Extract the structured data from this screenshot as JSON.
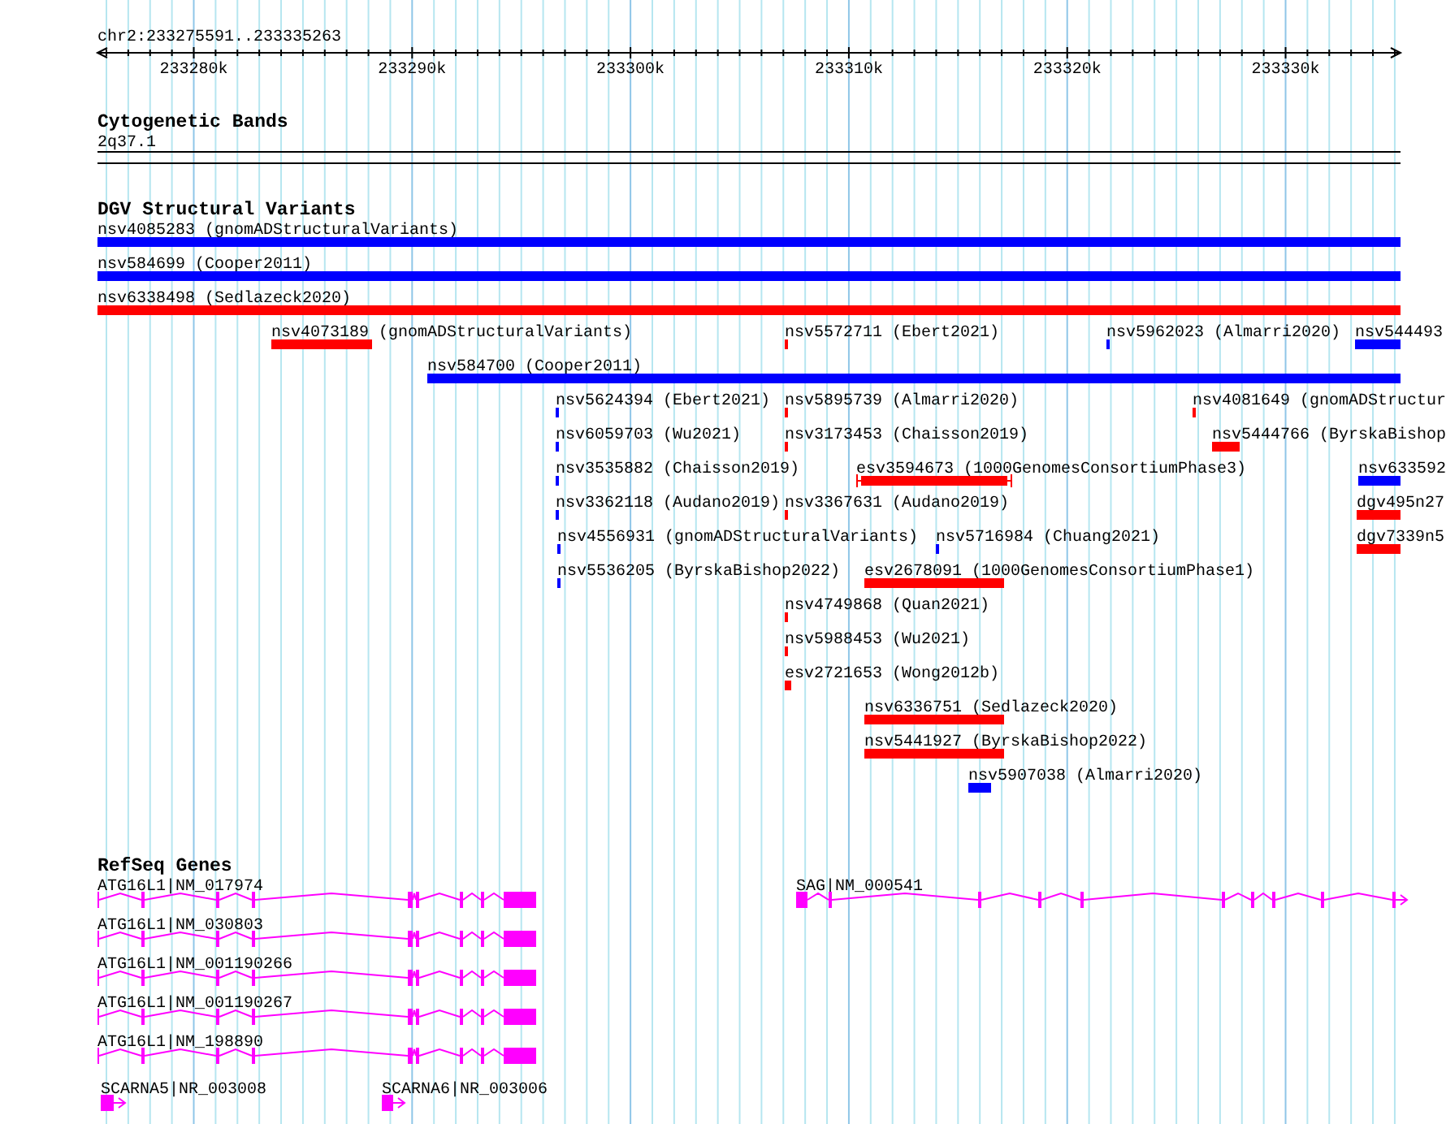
{
  "ruler": {
    "location": "chr2:233275591..233335263",
    "ticks": [
      "233280k",
      "233290k",
      "233300k",
      "233310k",
      "233320k",
      "233330k"
    ]
  },
  "tracks": [
    {
      "kind": "bands",
      "title": "Cytogenetic Bands",
      "bands": [
        {
          "name": "2q37.1"
        }
      ]
    },
    {
      "kind": "variants",
      "title": "DGV Structural Variants",
      "features": [
        {
          "label": "nsv4085283 (gnomADStructuralVariants)",
          "color": "#0000ff",
          "kind": "bar"
        },
        {
          "label": "nsv584699 (Cooper2011)",
          "color": "#0000ff",
          "kind": "bar"
        },
        {
          "label": "nsv6338498 (Sedlazeck2020)",
          "color": "#ff0000",
          "kind": "bar"
        },
        {
          "label": "nsv4073189 (gnomADStructuralVariants)",
          "color": "#ff0000",
          "kind": "bar"
        },
        {
          "label": "nsv5572711 (Ebert2021)",
          "color": "#ff0000",
          "kind": "bar"
        },
        {
          "label": "nsv5962023 (Almarri2020)",
          "color": "#0000ff",
          "kind": "bar"
        },
        {
          "label": "nsv544493",
          "color": "#0000ff",
          "kind": "bar"
        },
        {
          "label": "nsv584700 (Cooper2011)",
          "color": "#0000ff",
          "kind": "bar"
        },
        {
          "label": "nsv5624394 (Ebert2021)",
          "color": "#0000ff",
          "kind": "bar"
        },
        {
          "label": "nsv5895739 (Almarri2020)",
          "color": "#ff0000",
          "kind": "bar"
        },
        {
          "label": "nsv4081649 (gnomADStructur",
          "color": "#ff0000",
          "kind": "bar"
        },
        {
          "label": "nsv6059703 (Wu2021)",
          "color": "#0000ff",
          "kind": "bar"
        },
        {
          "label": "nsv3173453 (Chaisson2019)",
          "color": "#ff0000",
          "kind": "bar"
        },
        {
          "label": "nsv5444766 (ByrskaBishop",
          "color": "#ff0000",
          "kind": "bar"
        },
        {
          "label": "nsv3535882 (Chaisson2019)",
          "color": "#0000ff",
          "kind": "bar"
        },
        {
          "label": "esv3594673 (1000GenomesConsortiumPhase3)",
          "color": "#ff0000",
          "kind": "bounded"
        },
        {
          "label": "nsv633592",
          "color": "#0000ff",
          "kind": "bar"
        },
        {
          "label": "nsv3362118 (Audano2019)",
          "color": "#0000ff",
          "kind": "bar"
        },
        {
          "label": "nsv3367631 (Audano2019)",
          "color": "#ff0000",
          "kind": "bar"
        },
        {
          "label": "dgv495n27",
          "color": "#ff0000",
          "kind": "bar"
        },
        {
          "label": "nsv4556931 (gnomADStructuralVariants)",
          "color": "#0000ff",
          "kind": "bar"
        },
        {
          "label": "nsv5716984 (Chuang2021)",
          "color": "#0000ff",
          "kind": "bar"
        },
        {
          "label": "dgv7339n5",
          "color": "#ff0000",
          "kind": "bar"
        },
        {
          "label": "nsv5536205 (ByrskaBishop2022)",
          "color": "#0000ff",
          "kind": "bar"
        },
        {
          "label": "esv2678091 (1000GenomesConsortiumPhase1)",
          "color": "#ff0000",
          "kind": "bar"
        },
        {
          "label": "nsv4749868 (Quan2021)",
          "color": "#ff0000",
          "kind": "bar"
        },
        {
          "label": "nsv5988453 (Wu2021)",
          "color": "#ff0000",
          "kind": "bar"
        },
        {
          "label": "esv2721653 (Wong2012b)",
          "color": "#ff0000",
          "kind": "bar"
        },
        {
          "label": "nsv6336751 (Sedlazeck2020)",
          "color": "#ff0000",
          "kind": "bar"
        },
        {
          "label": "nsv5441927 (ByrskaBishop2022)",
          "color": "#ff0000",
          "kind": "bar"
        },
        {
          "label": "nsv5907038 (Almarri2020)",
          "color": "#0000ff",
          "kind": "bar"
        }
      ]
    },
    {
      "kind": "genes",
      "title": "RefSeq Genes",
      "features": [
        {
          "label": "ATG16L1|NM_017974"
        },
        {
          "label": "SAG|NM_000541"
        },
        {
          "label": "ATG16L1|NM_030803"
        },
        {
          "label": "ATG16L1|NM_001190266"
        },
        {
          "label": "ATG16L1|NM_001190267"
        },
        {
          "label": "ATG16L1|NM_198890"
        },
        {
          "label": "SCARNA5|NR_003008"
        },
        {
          "label": "SCARNA6|NR_003006"
        }
      ]
    }
  ]
}
